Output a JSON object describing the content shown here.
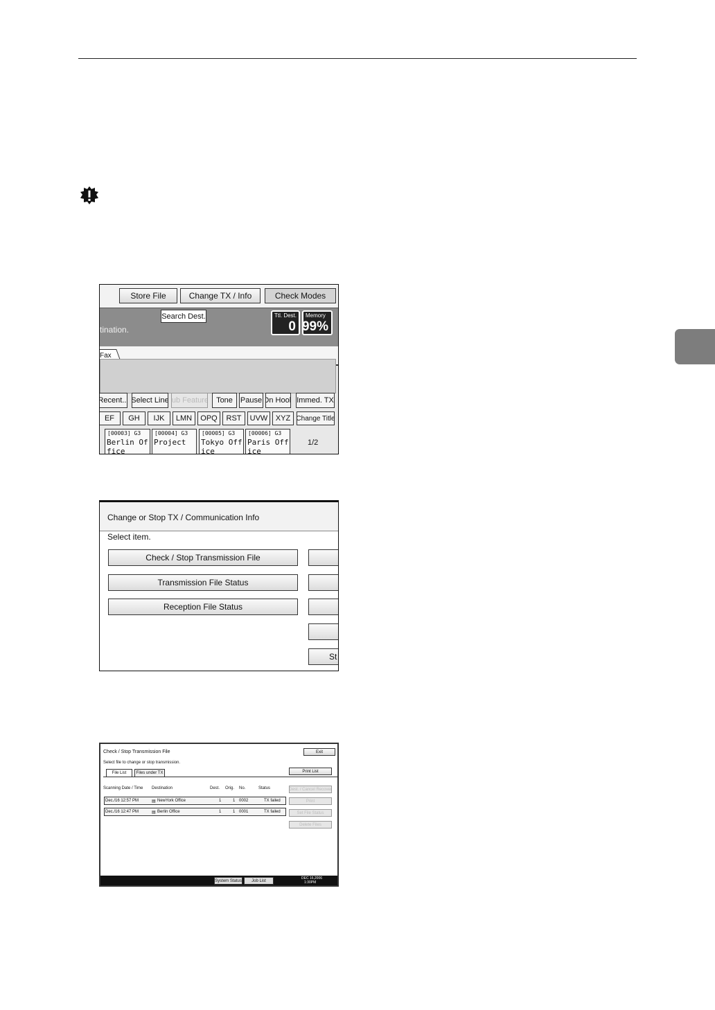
{
  "page": {
    "side_tab_color": "#7d7d7d"
  },
  "screen1": {
    "store_file": "Store File",
    "change_tx_info": "Change TX / Info",
    "check_modes": "Check Modes",
    "search_dest": "Search Dest.",
    "banner_text": "tination.",
    "ttl_dest_label": "Ttl. Dest.",
    "ttl_dest_value": "0",
    "memory_label": "Memory",
    "memory_value": "99%",
    "fax_tab": "Fax",
    "recent": "Recent...",
    "select_line": "Select Line",
    "sub_features": "Sub Features",
    "tone": "Tone",
    "pause": "Pause",
    "on_hook": "On Hook",
    "immed_tx": "Immed. TX",
    "alpha_keys": [
      "EF",
      "GH",
      "IJK",
      "LMN",
      "OPQ",
      "RST",
      "UVW",
      "XYZ"
    ],
    "change_title": "Change Title",
    "destinations": [
      {
        "code": "[00003] G3",
        "name": "Berlin Office"
      },
      {
        "code": "[00004] G3",
        "name": "Project"
      },
      {
        "code": "[00005] G3",
        "name": "Tokyo Office"
      },
      {
        "code": "[00006] G3",
        "name": "Paris Office"
      }
    ],
    "page_indicator": "1/2"
  },
  "screen2": {
    "title": "Change or Stop TX / Communication Info",
    "prompt": "Select item.",
    "buttons": [
      "Check / Stop Transmission File",
      "Transmission File Status",
      "Reception File Status"
    ],
    "cut_label": "St"
  },
  "screen3": {
    "title": "Check / Stop Transmission File",
    "exit": "Exit",
    "prompt": "Select file to change or stop transmission.",
    "tab_file_list": "File List",
    "tab_files_under_tx": "Files under TX",
    "print_list": "Print List",
    "headers": [
      "Scanning Date / Time",
      "Destination",
      "Dest.",
      "Orig.",
      "No.",
      "Status"
    ],
    "rows": [
      {
        "time": "Dec./16 12:57 PM",
        "dest": "NewYork Office",
        "dest_n": "1",
        "orig": "1",
        "no": "0002",
        "status": "TX failed"
      },
      {
        "time": "Dec./16 12:47 PM",
        "dest": "Berlin Office",
        "dest_n": "1",
        "orig": "1",
        "no": "0001",
        "status": "TX failed"
      }
    ],
    "side_buttons": [
      "Dest. / Cancel Recover",
      "Print",
      "Set File Status",
      "Delete Files"
    ],
    "system_status": "System Status",
    "job_list": "Job List",
    "clock_date": "DEC 16,2006",
    "clock_time": "1:30PM"
  }
}
